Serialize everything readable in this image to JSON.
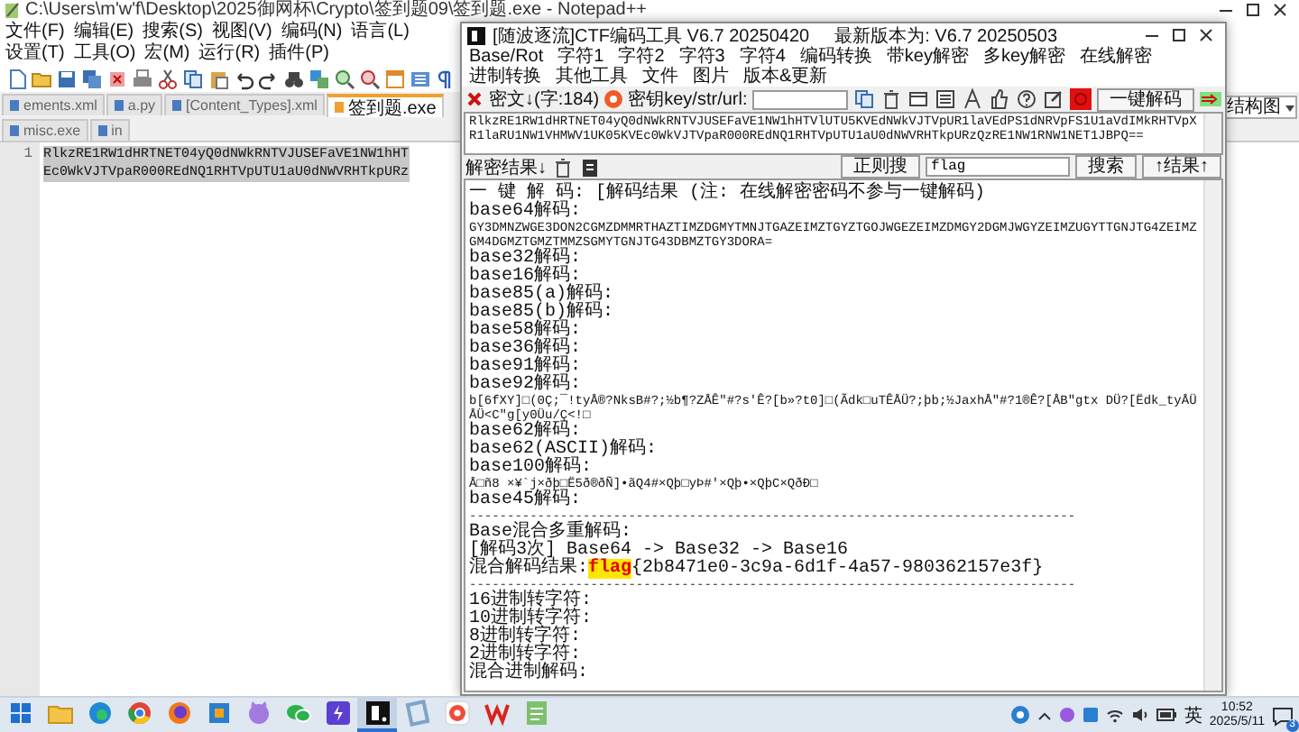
{
  "notepad": {
    "title": "C:\\Users\\m'w'f\\Desktop\\2025御网杯\\Crypto\\签到题09\\签到题.exe - Notepad++",
    "menu": [
      "文件(F)",
      "编辑(E)",
      "搜索(S)",
      "视图(V)",
      "编码(N)",
      "语言(L)",
      "设置(T)",
      "工具(O)",
      "宏(M)",
      "运行(R)",
      "插件(P)"
    ],
    "tabs": [
      {
        "label": "ements.xml",
        "selected": false
      },
      {
        "label": "a.py",
        "selected": false
      },
      {
        "label": "[Content_Types].xml",
        "selected": false
      },
      {
        "label": "签到题.exe",
        "selected": true
      },
      {
        "label": "misc.exe",
        "selected": false
      },
      {
        "label": "in",
        "selected": false
      }
    ],
    "structure_combo": "结构图",
    "line_number": "1",
    "lines": [
      "RlkzRE1RW1dHRTNET04yQ0dNWkRNTVJUSEFaVE1NW1hHT",
      "Ec0WkVJTVpaR000REdNQ1RHTVpUTU1aU0dNWVRHTkpURz"
    ]
  },
  "ctf": {
    "title": "[随波逐流]CTF编码工具 V6.7 20250420",
    "latest": "最新版本为: V6.7  20250503",
    "menu": [
      "Base/Rot",
      "字符1",
      "字符2",
      "字符3",
      "字符4",
      "编码转换",
      "带key解密",
      "多key解密",
      "在线解密",
      "进制转换",
      "其他工具",
      "文件",
      "图片",
      "版本&更新"
    ],
    "cipher_label": "密文↓(字:184)",
    "key_label": "密钥key/str/url:",
    "decode_button": "一键解码",
    "ciphertext": "RlkzRE1RW1dHRTNET04yQ0dNWkRNTVJUSEFaVE1NW1hHTVlUTU5KVEdNWkVJTVpUR1laVEdPS1dNRVpFS1U1aVdIMkRHTVpXR1laRU1NW1VHMWV1UK05KVEc0WkVJTVpaR000REdNQ1RHTVpUTU1aU0dNWVRHTkpURzQzRE1NW1RNW1NET1JBPQ==",
    "results_label": "解密结果↓",
    "regex_button": "正则搜",
    "search_value": "flag",
    "search_button": "搜索",
    "result_nav_button": "↑结果↑",
    "results": [
      {
        "kind": "header",
        "label": "一 键 解 码:",
        "value": "[解码结果 (注: 在线解密密码不参与一键解码)"
      },
      {
        "kind": "result",
        "label": "base64解码:",
        "value": "GY3DMNZWGE3DON2CGMZDMMRTHAZTIMZDGMYTMNJTGAZEIMZTGYZTGOJWGEZEIMZDMGY2DGMJWGYZEIMZUGYTTGNJTG4ZEIMZGM4DGMZTGMZTMMZSGMYTGNJTG43DBMZTGY3DORA="
      },
      {
        "kind": "result",
        "label": "base32解码:"
      },
      {
        "kind": "result",
        "label": "base16解码:"
      },
      {
        "kind": "result",
        "label": "base85(a)解码:"
      },
      {
        "kind": "result",
        "label": "base85(b)解码:"
      },
      {
        "kind": "result",
        "label": "base58解码:"
      },
      {
        "kind": "result",
        "label": "base36解码:"
      },
      {
        "kind": "result",
        "label": "base91解码:"
      },
      {
        "kind": "result",
        "label": "base92解码:",
        "value": "b[6fXY]□(0Ç;¯!tyÅ®?NksB#?;½b¶?ZÅÊ\"#?s'Ê?[b»?t0]□(Ãdk□uTÊÅÜ?;þb;½JaxhÅ\"#?1®Ê?[ÅB\"gtx DÜ?[Ëdk_tyÅÜ ÅÜ<C\"g[y0Üu/Ç<!□"
      },
      {
        "kind": "result",
        "label": "base62解码:"
      },
      {
        "kind": "result",
        "label": "base62(ASCII)解码:"
      },
      {
        "kind": "result",
        "label": "base100解码:",
        "value": "Å□ñ8 ×¥`j×ðþ□Ë5ð®ðÑ]•ãQ4#×Qþ□yÞ#'×Qþ•×QþC×QðÐ□"
      },
      {
        "kind": "result",
        "label": "base45解码:"
      },
      {
        "kind": "separator",
        "label": "--------------------------------------------------------------------------------"
      },
      {
        "kind": "text",
        "label": "Base混合多重解码:"
      },
      {
        "kind": "text",
        "label": "[解码3次] Base64 -> Base32 -> Base16"
      },
      {
        "kind": "flag",
        "label": "混合解码结果:",
        "match": "flag",
        "value": "{2b8471e0-3c9a-6d1f-4a57-980362157e3f}"
      },
      {
        "kind": "separator",
        "label": "--------------------------------------------------------------------------------"
      },
      {
        "kind": "result",
        "label": "16进制转字符:"
      },
      {
        "kind": "result",
        "label": "10进制转字符:"
      },
      {
        "kind": "result",
        "label": "8进制转字符:"
      },
      {
        "kind": "result",
        "label": "2进制转字符:"
      },
      {
        "kind": "result",
        "label": "混合进制解码:"
      }
    ]
  },
  "taskbar": {
    "apps": [
      {
        "active": false
      },
      {
        "active": false
      },
      {
        "active": false
      },
      {
        "active": false
      },
      {
        "active": false
      },
      {
        "active": false
      },
      {
        "active": false
      },
      {
        "active": false
      },
      {
        "active": true
      },
      {
        "active": false
      },
      {
        "active": false
      },
      {
        "active": false
      },
      {
        "active": false
      }
    ],
    "ime": "英",
    "time": "10:52",
    "date": "2025/5/11",
    "notifications": "3"
  }
}
